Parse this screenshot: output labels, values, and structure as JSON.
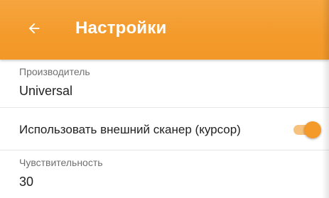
{
  "appbar": {
    "title": "Настройки",
    "back_icon": "arrow-left-icon",
    "background_color": "#f39a2b",
    "title_color": "#ffffff"
  },
  "settings": {
    "manufacturer": {
      "label": "Производитель",
      "value": "Universal"
    },
    "external_scanner": {
      "label": "Использовать внешний сканер (курсор)",
      "enabled": true,
      "accent_color": "#f39a2b"
    },
    "sensitivity": {
      "label": "Чувствительность",
      "value": "30"
    }
  }
}
